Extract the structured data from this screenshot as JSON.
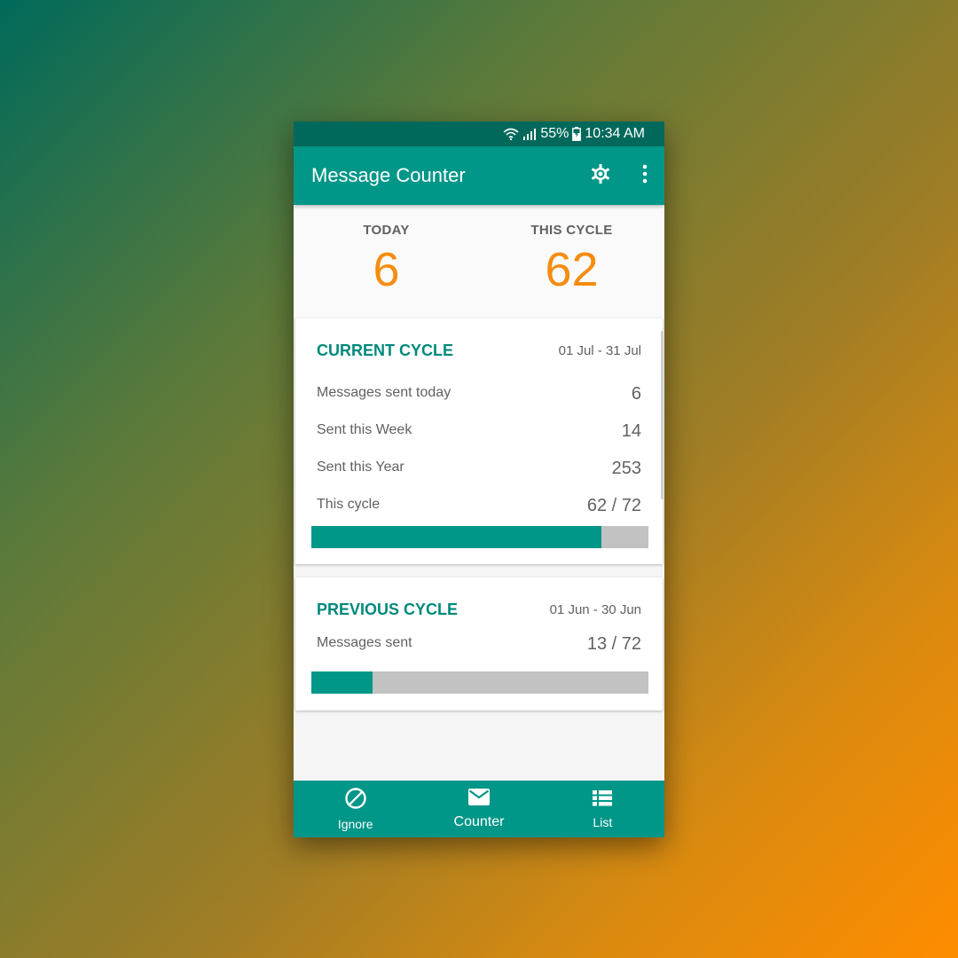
{
  "status_bar": {
    "battery": "55%",
    "time": "10:34 AM"
  },
  "app_bar": {
    "title": "Message Counter",
    "icons": [
      "gear-icon",
      "more-vert-icon"
    ]
  },
  "summary": {
    "today_label": "TODAY",
    "today_value": "6",
    "cycle_label": "THIS CYCLE",
    "cycle_value": "62"
  },
  "current_cycle": {
    "title": "CURRENT CYCLE",
    "dates": "01 Jul - 31 Jul",
    "rows": [
      {
        "label": "Messages sent today",
        "value": "6"
      },
      {
        "label": "Sent this Week",
        "value": "14"
      },
      {
        "label": "Sent this Year",
        "value": "253"
      },
      {
        "label": "This cycle",
        "value": "62 / 72"
      }
    ],
    "progress": 0.861
  },
  "previous_cycle": {
    "title": "PREVIOUS CYCLE",
    "dates": "01 Jun - 30 Jun",
    "rows": [
      {
        "label": "Messages sent",
        "value": "13 / 72"
      }
    ],
    "progress": 0.181
  },
  "bottom_nav": {
    "items": [
      {
        "label": "Ignore",
        "icon": "block-icon"
      },
      {
        "label": "Counter",
        "icon": "mail-icon"
      },
      {
        "label": "List",
        "icon": "list-icon"
      }
    ],
    "active_index": 1
  },
  "colors": {
    "primary": "#009688",
    "primary_dark": "#00695c",
    "accent": "#f68c0e"
  }
}
